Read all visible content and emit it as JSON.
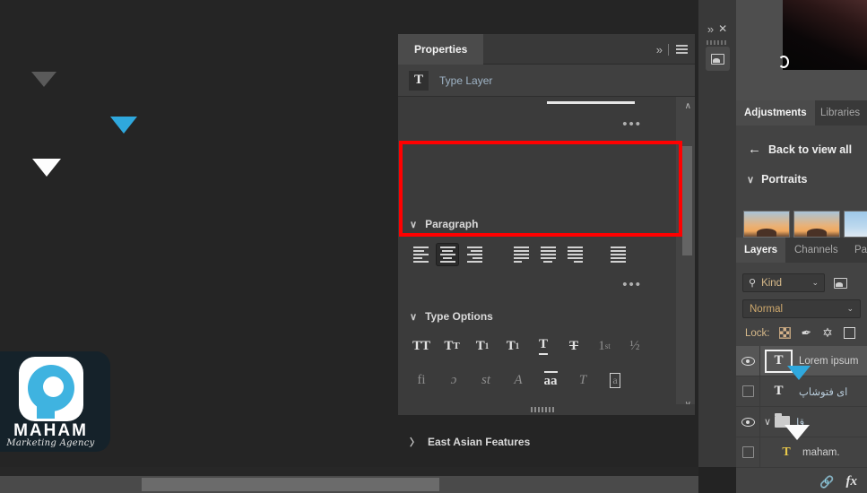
{
  "canvas": {
    "arrows": [
      {
        "name": "gray-down-arrow",
        "color": "#5a5a5a"
      },
      {
        "name": "cyan-down-arrow",
        "color": "#2fa8dd"
      },
      {
        "name": "white-down-arrow",
        "color": "#fdfdfd"
      }
    ]
  },
  "logo": {
    "name": "MAHAM",
    "tagline": "Marketing Agency",
    "accent": "#3fb3e0",
    "card_bg": "#15222a"
  },
  "properties": {
    "tab_label": "Properties",
    "expand_icon": "»",
    "menu_icon": "hamburger-menu-icon",
    "type_layer": {
      "icon_glyph": "T",
      "label": "Type Layer"
    },
    "overflow_dots": "•••",
    "paragraph": {
      "title": "Paragraph",
      "expanded": true,
      "highlight_color": "#ff0000",
      "alignment_buttons": [
        {
          "name": "align-left",
          "selected": false,
          "widths": [
            100,
            72,
            100,
            60,
            100
          ]
        },
        {
          "name": "align-center",
          "selected": true,
          "widths": [
            100,
            72,
            100,
            60,
            100
          ]
        },
        {
          "name": "align-right",
          "selected": false,
          "widths": [
            100,
            72,
            100,
            60,
            100
          ]
        },
        {
          "name": "justify-last-left",
          "selected": false,
          "widths": [
            100,
            100,
            100,
            100,
            58
          ]
        },
        {
          "name": "justify-last-center",
          "selected": false,
          "widths": [
            100,
            100,
            100,
            100,
            58
          ]
        },
        {
          "name": "justify-last-right",
          "selected": false,
          "widths": [
            100,
            100,
            100,
            100,
            58
          ]
        },
        {
          "name": "justify-all",
          "selected": false,
          "widths": [
            100,
            100,
            100,
            100,
            100
          ]
        }
      ],
      "overflow_dots": "•••"
    },
    "type_options": {
      "title": "Type Options",
      "expanded": true,
      "row1": [
        {
          "name": "all-caps-button",
          "glyph": "TT",
          "enabled": true
        },
        {
          "name": "small-caps-button",
          "glyph": "Tᴛ",
          "enabled": true
        },
        {
          "name": "superscript-button",
          "glyph": "T¹",
          "enabled": true
        },
        {
          "name": "subscript-button",
          "glyph": "T₁",
          "enabled": true
        },
        {
          "name": "underline-button",
          "glyph": "T",
          "enabled": true
        },
        {
          "name": "strikethrough-button",
          "glyph": "T",
          "enabled": true
        },
        {
          "name": "ordinals-button",
          "glyph": "1st",
          "enabled": true
        },
        {
          "name": "fractions-button",
          "glyph": "½",
          "enabled": true
        }
      ],
      "row2": [
        {
          "name": "standard-ligatures-button",
          "glyph": "fi",
          "enabled": false
        },
        {
          "name": "discretionary-ligatures-button",
          "glyph": "ɔ̵",
          "enabled": false
        },
        {
          "name": "contextual-alternates-button",
          "glyph": "st",
          "enabled": false
        },
        {
          "name": "swash-button",
          "glyph": "𝒜",
          "enabled": false
        },
        {
          "name": "titling-alternates-button",
          "glyph": "aa",
          "enabled": false
        },
        {
          "name": "stylistic-alternates-button",
          "glyph": "T",
          "enabled": false
        },
        {
          "name": "ornaments-button",
          "glyph": "a",
          "enabled": false
        }
      ],
      "overflow_dots": "•••"
    },
    "east_asian": {
      "title": "East Asian Features",
      "expanded": false
    }
  },
  "mini_dock": {
    "expand_icon": "»",
    "close_icon": "✕",
    "library_button": "photo-library-icon"
  },
  "adjustments": {
    "tabs": [
      {
        "name": "tab-adjustments",
        "label": "Adjustments",
        "active": true
      },
      {
        "name": "tab-libraries",
        "label": "Libraries",
        "active": false
      }
    ],
    "back_label": "Back to view all",
    "group_title": "Portraits",
    "presets": [
      {
        "name": "preset-thumb-1",
        "kind": "sunset"
      },
      {
        "name": "preset-thumb-2",
        "kind": "sunset"
      },
      {
        "name": "preset-thumb-3",
        "kind": "cool"
      }
    ]
  },
  "layers": {
    "tabs": [
      {
        "name": "tab-layers",
        "label": "Layers",
        "active": true
      },
      {
        "name": "tab-channels",
        "label": "Channels",
        "active": false
      },
      {
        "name": "tab-paths",
        "label": "Pa",
        "active": false
      }
    ],
    "filter": {
      "label": "Kind",
      "search_icon": "search-icon",
      "chevron": "⌄",
      "pixel_filter_icon": "image-filter-icon"
    },
    "blend_mode": {
      "value": "Normal",
      "chevron": "⌄"
    },
    "lock": {
      "label": "Lock:",
      "buttons": [
        {
          "name": "lock-transparent-pixels",
          "icon": "checker-icon"
        },
        {
          "name": "lock-image-pixels",
          "icon": "brush-icon",
          "glyph": "✎"
        },
        {
          "name": "lock-position",
          "icon": "move-icon",
          "glyph": "✥"
        },
        {
          "name": "lock-artboard-nesting",
          "icon": "artboard-icon"
        }
      ]
    },
    "rows": [
      {
        "name": "layer-row-lorem-ipsum",
        "visible": true,
        "selected": true,
        "thumb_glyph": "T",
        "thumb_outlined": true,
        "label": "Lorem ipsum",
        "rtl": false
      },
      {
        "name": "layer-row-persian-text",
        "visible": false,
        "selected": false,
        "thumb_glyph": "T",
        "thumb_outlined": false,
        "label": "ای فتوشاپ",
        "rtl": true
      },
      {
        "name": "layer-row-group",
        "visible": true,
        "selected": false,
        "thumb_glyph": "",
        "thumb_outlined": false,
        "label": "قا",
        "rtl": true,
        "is_group": true
      },
      {
        "name": "layer-row-maham",
        "visible": false,
        "selected": false,
        "thumb_glyph": "T",
        "thumb_outlined": false,
        "label": "maham.",
        "rtl": false,
        "has_warning": true
      }
    ],
    "footer": {
      "link_icon": "link-layers-icon",
      "fx_icon": "layer-styles-icon",
      "fx_label": "fx"
    }
  },
  "gradient_swatch": {
    "name": "dark-red-gradient-swatch",
    "colors": [
      "#4a2a2a",
      "#2a1616",
      "#0b0708",
      "#050505"
    ]
  }
}
